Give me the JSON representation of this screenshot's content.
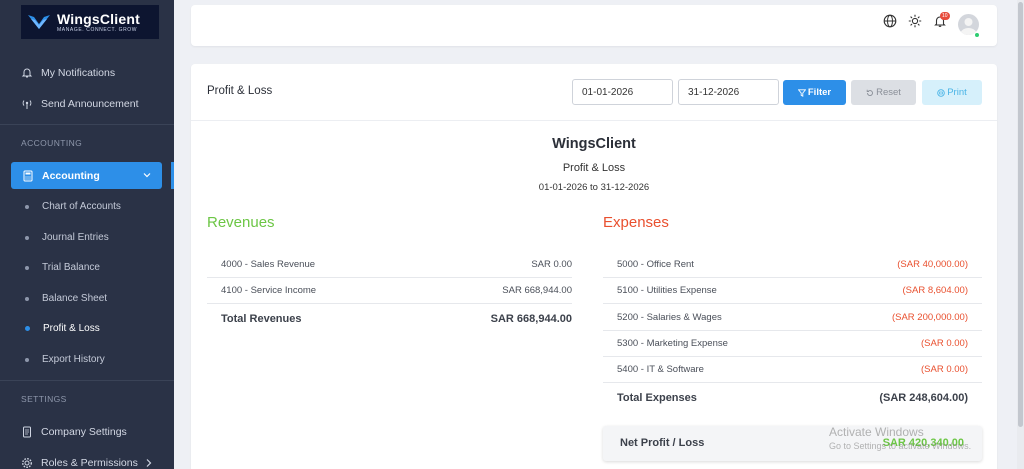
{
  "brand": {
    "name": "WingsClient",
    "tagline": "MANAGE. CONNECT. GROW"
  },
  "sidebar": {
    "items": [
      {
        "label": "My Notifications",
        "icon": "bell-icon"
      },
      {
        "label": "Send Announcement",
        "icon": "broadcast-icon"
      }
    ],
    "sections": {
      "accounting": "ACCOUNTING",
      "settings": "SETTINGS"
    },
    "accounting": {
      "label": "Accounting",
      "icon": "calculator-icon",
      "sub_items": [
        "Chart of Accounts",
        "Journal Entries",
        "Trial Balance",
        "Balance Sheet",
        "Profit & Loss",
        "Export History"
      ],
      "current": "Profit & Loss"
    },
    "settings_items": [
      {
        "label": "Company Settings",
        "icon": "document-icon"
      },
      {
        "label": "Roles & Permissions",
        "icon": "gear-icon"
      }
    ]
  },
  "topbar": {
    "notification_count": "10"
  },
  "report_header": {
    "title": "Profit & Loss",
    "from_date": "01-01-2026",
    "to_date": "31-12-2026",
    "filter_label": "Filter",
    "reset_label": "Reset",
    "print_label": "Print"
  },
  "report": {
    "company": "WingsClient",
    "name": "Profit & Loss",
    "range": "01-01-2026 to 31-12-2026",
    "revenues": {
      "heading": "Revenues",
      "rows": [
        {
          "account": "4000 - Sales Revenue",
          "amount": "SAR 0.00"
        },
        {
          "account": "4100 - Service Income",
          "amount": "SAR 668,944.00"
        }
      ],
      "total_label": "Total Revenues",
      "total_amount": "SAR 668,944.00"
    },
    "expenses": {
      "heading": "Expenses",
      "rows": [
        {
          "account": "5000 - Office Rent",
          "amount": "(SAR 40,000.00)"
        },
        {
          "account": "5100 - Utilities Expense",
          "amount": "(SAR 8,604.00)"
        },
        {
          "account": "5200 - Salaries & Wages",
          "amount": "(SAR 200,000.00)"
        },
        {
          "account": "5300 - Marketing Expense",
          "amount": "(SAR 0.00)"
        },
        {
          "account": "5400 - IT & Software",
          "amount": "(SAR 0.00)"
        }
      ],
      "total_label": "Total Expenses",
      "total_amount": "(SAR 248,604.00)"
    },
    "net": {
      "label": "Net Profit / Loss",
      "amount": "SAR 420,340.00"
    }
  },
  "watermark": {
    "line1": "Activate Windows",
    "line2": "Go to Settings to activate Windows."
  },
  "colors": {
    "sidebar": "#2a3246",
    "accent": "#2d8fe8",
    "revenue": "#6cc645",
    "expense": "#e9502f"
  }
}
